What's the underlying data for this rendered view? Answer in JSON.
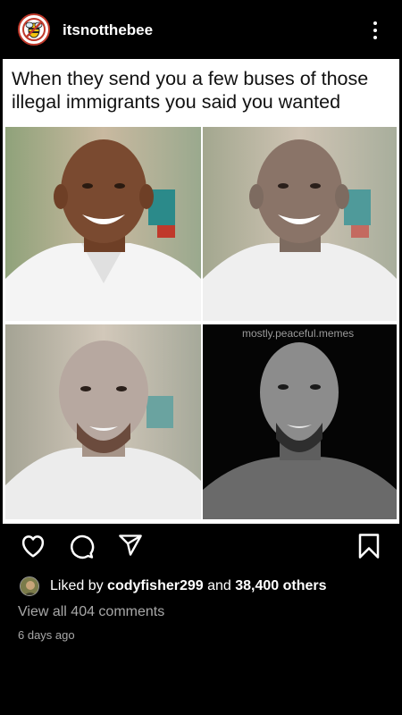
{
  "header": {
    "username": "itsnotthebee",
    "avatar_icon": "bee-logo-icon",
    "more_icon": "more-vertical-icon"
  },
  "post": {
    "caption": "When they send you a few buses of those illegal immigrants you said you wanted",
    "watermark": "mostly.peaceful.memes",
    "images": [
      {
        "icon": "portrait-photo-natural",
        "tone": "#7a4a30"
      },
      {
        "icon": "portrait-photo-lightened",
        "tone": "#8a7468"
      },
      {
        "icon": "portrait-photo-lighter",
        "tone": "#b7a8a0"
      },
      {
        "icon": "portrait-photo-grayscale",
        "tone": "#8c8c8c"
      }
    ]
  },
  "actions": {
    "like_icon": "heart-icon",
    "comment_icon": "comment-icon",
    "share_icon": "send-icon",
    "save_icon": "bookmark-icon"
  },
  "likes": {
    "prefix": "Liked by ",
    "user": "codyfisher299",
    "middle": " and ",
    "others": "38,400 others"
  },
  "comments_link": "View all 404 comments",
  "timestamp": "6 days ago"
}
